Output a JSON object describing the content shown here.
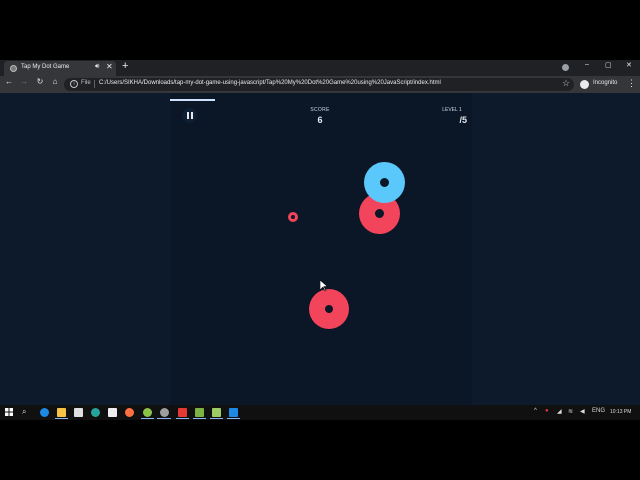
{
  "browser": {
    "tab_title": "Tap My Dot Game",
    "tab_audio_icon": "speaker-icon",
    "tab_close": "✕",
    "new_tab": "+",
    "window_controls": [
      "–",
      "▢",
      "✕"
    ],
    "file_label": "File",
    "url": "C:/Users/SIKHA/Downloads/tap-my-dot-game-using-javascript/Tap%20My%20Dot%20Game%20using%20JavaScript/index.html",
    "incognito_label": "Incognito",
    "nav_icons": [
      "←",
      "→",
      "↻",
      "⌂"
    ],
    "menu_icon": "⋮",
    "star_icon": "☆"
  },
  "game": {
    "score_label": "SCORE",
    "score_value": "6",
    "level_label": "LEVEL 1",
    "level_value": "/5",
    "dot_colors": {
      "blue": "#5ac8fa",
      "red": "#f2455b"
    }
  },
  "taskbar": {
    "lang": "ENG",
    "time": "10:13 PM"
  }
}
